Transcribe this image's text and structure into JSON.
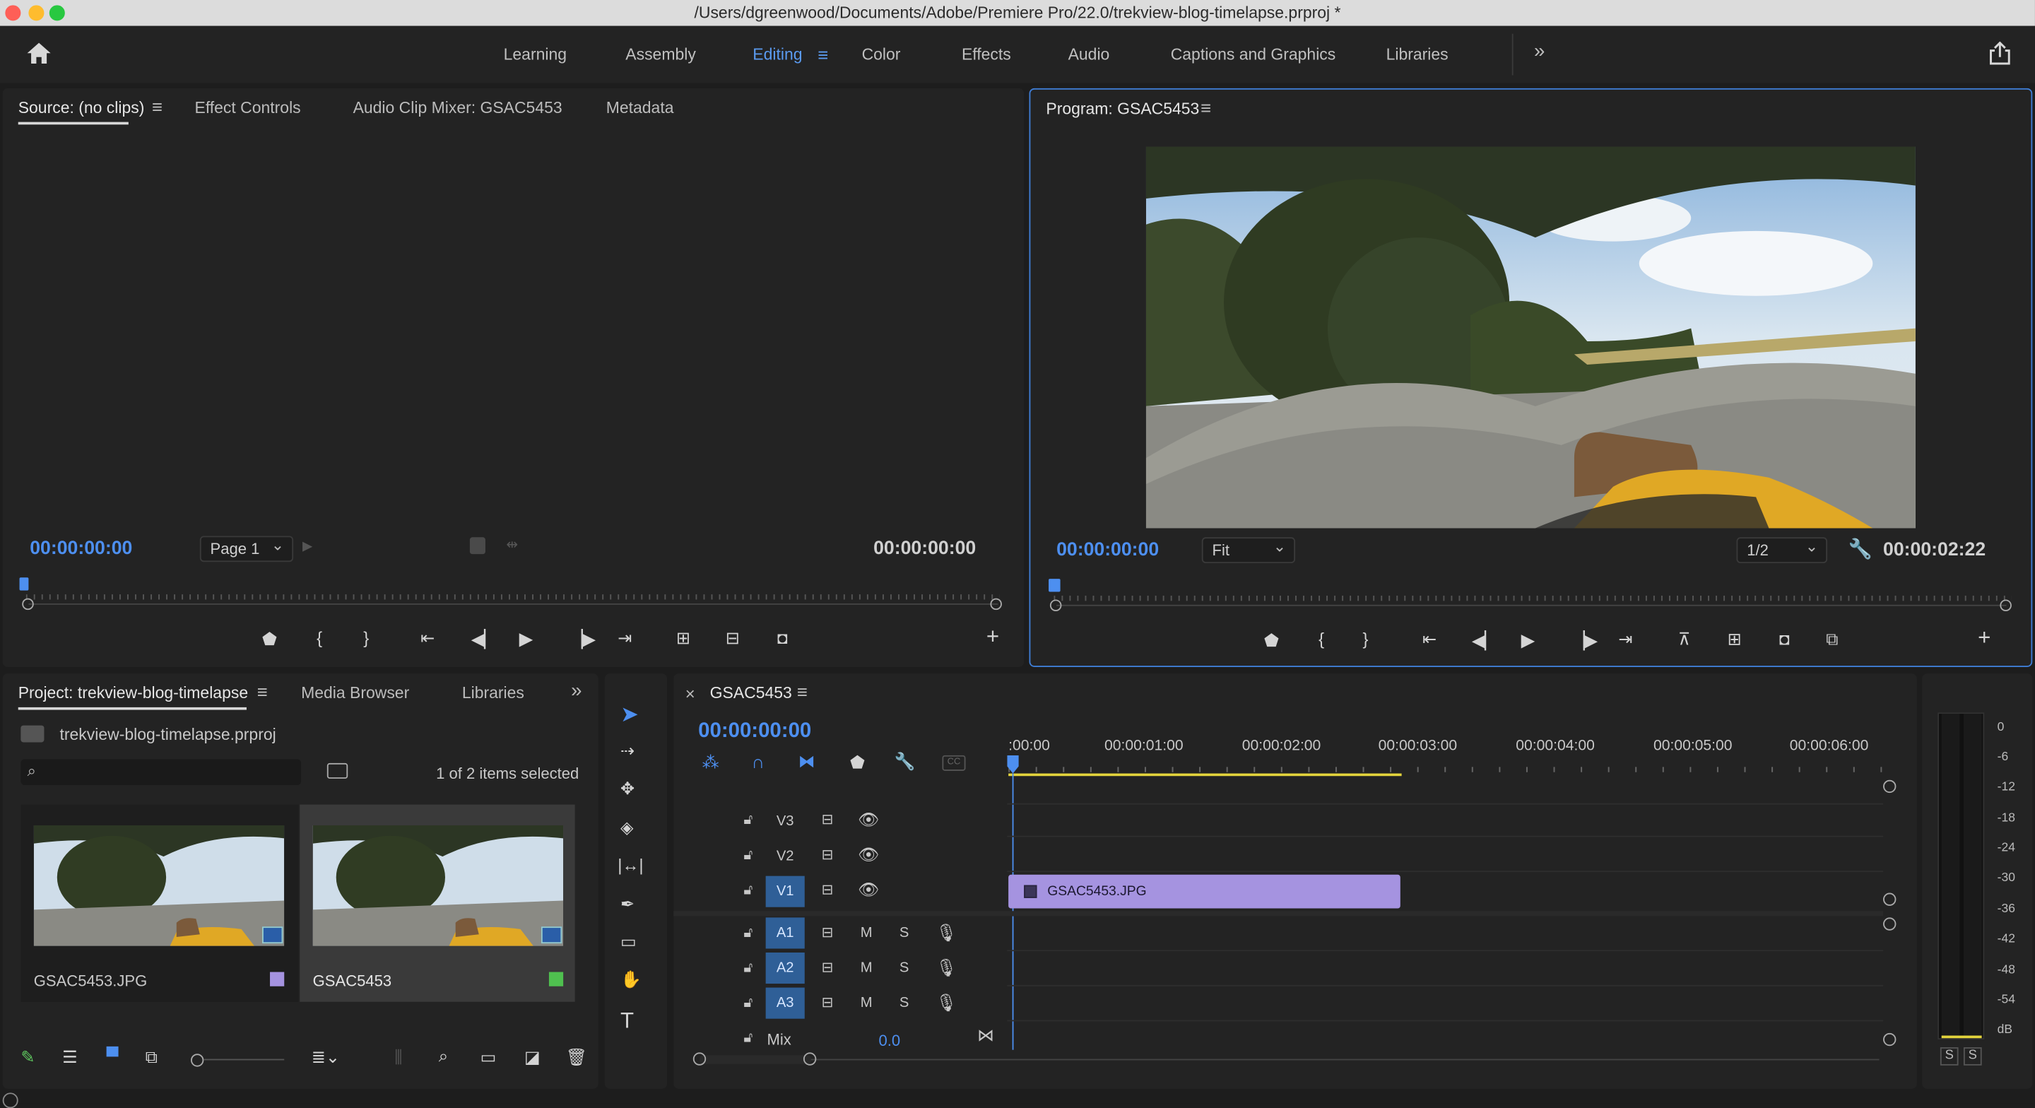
{
  "window": {
    "title": "/Users/dgreenwood/Documents/Adobe/Premiere Pro/22.0/trekview-blog-timelapse.prproj *"
  },
  "workspaces": {
    "items": [
      "Learning",
      "Assembly",
      "Editing",
      "Color",
      "Effects",
      "Audio",
      "Captions and Graphics",
      "Libraries"
    ],
    "active": "Editing",
    "overflow": "»"
  },
  "source_panel": {
    "tabs": [
      "Source: (no clips)",
      "Effect Controls",
      "Audio Clip Mixer: GSAC5453",
      "Metadata"
    ],
    "timecode_in": "00:00:00:00",
    "timecode_out": "00:00:00:00",
    "page_select": "Page 1"
  },
  "program_panel": {
    "tab": "Program: GSAC5453",
    "timecode_in": "00:00:00:00",
    "fit_select": "Fit",
    "resolution_select": "1/2",
    "timecode_out": "00:00:02:22"
  },
  "project_panel": {
    "tabs": [
      "Project: trekview-blog-timelapse",
      "Media Browser",
      "Libraries"
    ],
    "project_file": "trekview-blog-timelapse.prproj",
    "search_placeholder": "",
    "selection_status": "1 of 2 items selected",
    "items": [
      {
        "name": "GSAC5453.JPG",
        "label_color": "#a593e0",
        "selected": false
      },
      {
        "name": "GSAC5453",
        "label_color": "#4fc04f",
        "selected": true
      }
    ]
  },
  "timeline": {
    "tab": "GSAC5453",
    "close_glyph": "×",
    "timecode": "00:00:00:00",
    "ruler_labels": [
      ":00:00",
      "00:00:01:00",
      "00:00:02:00",
      "00:00:03:00",
      "00:00:04:00",
      "00:00:05:00",
      "00:00:06:00"
    ],
    "video_tracks": [
      "V3",
      "V2",
      "V1"
    ],
    "audio_tracks": [
      "A1",
      "A2",
      "A3"
    ],
    "mix_label": "Mix",
    "mix_value": "0.0",
    "audio_buttons": {
      "mute": "M",
      "solo": "S"
    },
    "clip": {
      "name": "GSAC5453.JPG",
      "color": "#a593e0"
    }
  },
  "meter": {
    "scale": [
      "0",
      "-6",
      "-12",
      "-18",
      "-24",
      "-30",
      "-36",
      "-42",
      "-48",
      "-54",
      "dB"
    ],
    "solo_buttons": [
      "S",
      "S"
    ]
  },
  "colors": {
    "accent": "#4d8ff0",
    "clip": "#a593e0",
    "workarea": "#e3d43c"
  }
}
